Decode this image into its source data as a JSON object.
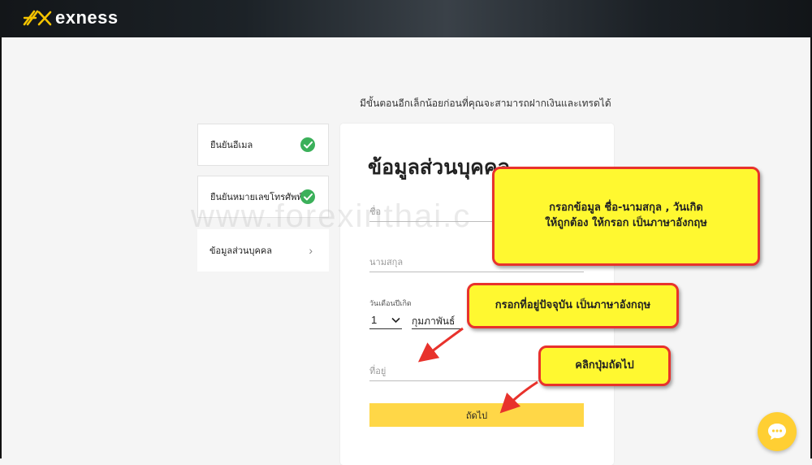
{
  "header": {
    "brand": "exness"
  },
  "subtitle": "มีขั้นตอนอีกเล็กน้อยก่อนที่คุณจะสามารถฝากเงินและเทรดได้",
  "steps": [
    {
      "label": "ยืนยันอีเมล",
      "status": "done"
    },
    {
      "label": "ยืนยันหมายเลขโทรศัพท์",
      "status": "done"
    },
    {
      "label": "ข้อมูลส่วนบุคคล",
      "status": "current"
    }
  ],
  "form": {
    "title": "ข้อมูลส่วนบุคคล",
    "first_name_placeholder": "ชื่อ",
    "last_name_placeholder": "นามสกุล",
    "dob_label": "วันเดือนปีเกิด",
    "dob_day": "1",
    "dob_month": "กุมภาพันธ์",
    "address_placeholder": "ที่อยู่",
    "next_label": "ถัดไป"
  },
  "watermark": "www.forexinthai.c",
  "callouts": {
    "names_line1": "กรอกข้อมูล  ชื่อ-นามสกุล , วันเกิด",
    "names_line2": "ให้ถูกต้อง ให้กรอก เป็นภาษาอังกฤษ",
    "address": "กรอกที่อยู่ปัจจุบัน เป็นภาษาอังกฤษ",
    "next": "คลิกปุ่มถัดไป"
  },
  "colors": {
    "accent_yellow": "#ffd747",
    "success_green": "#3bb05a",
    "callout_fill": "#fff830",
    "callout_border": "#e8322c"
  },
  "icons": [
    "exness-logo-icon",
    "check-icon",
    "chevron-right-icon",
    "chevron-down-icon",
    "chat-icon"
  ]
}
